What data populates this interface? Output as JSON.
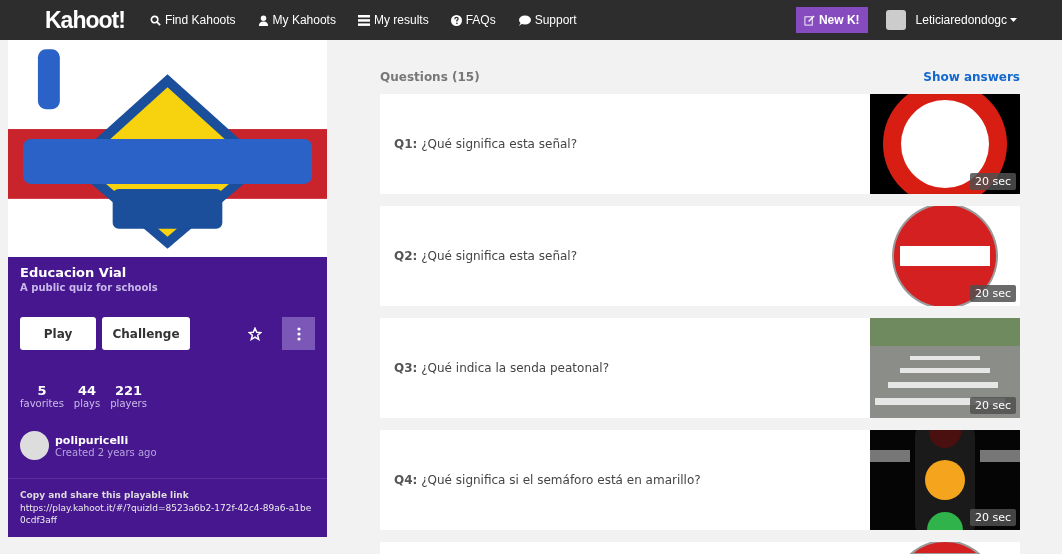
{
  "navbar": {
    "logo": "Kahoot!",
    "links": [
      {
        "kind": "search",
        "label": "Find Kahoots"
      },
      {
        "kind": "user",
        "label": "My Kahoots"
      },
      {
        "kind": "list",
        "label": "My results"
      },
      {
        "kind": "question",
        "label": "FAQs"
      },
      {
        "kind": "chat",
        "label": "Support"
      }
    ],
    "new_button": "New K!",
    "username": "Leticiaredondogc"
  },
  "quiz": {
    "title": "Educacion Vial",
    "subtitle": "A public quiz for schools",
    "play": "Play",
    "challenge": "Challenge",
    "favorited": false,
    "stats": [
      {
        "value": "5",
        "label": "favorites"
      },
      {
        "value": "44",
        "label": "plays"
      },
      {
        "value": "221",
        "label": "players"
      }
    ],
    "author": {
      "name": "polipuricelli",
      "created": "Created 2 years ago"
    },
    "share": {
      "heading": "Copy and share this playable link",
      "link": "https://play.kahoot.it/#/?quizId=8523a6b2-172f-42c4-89a6-a1be0cdf3aff"
    }
  },
  "questions_header": {
    "title": "Questions (15)",
    "action": "Show answers"
  },
  "questions": [
    {
      "number": "Q1:",
      "text": "¿Qué significa esta señal?",
      "kind": "speed-limit",
      "time": "20 sec"
    },
    {
      "number": "Q2:",
      "text": "¿Qué significa esta señal?",
      "kind": "no-entry",
      "time": "20 sec"
    },
    {
      "number": "Q3:",
      "text": "¿Qué indica la senda peatonal?",
      "kind": "crosswalk",
      "time": "20 sec"
    },
    {
      "number": "Q4:",
      "text": "¿Qué significa si el semáforo está en amarillo?",
      "kind": "traffic-light",
      "time": "20 sec"
    },
    {
      "kind": "sign-top"
    }
  ]
}
